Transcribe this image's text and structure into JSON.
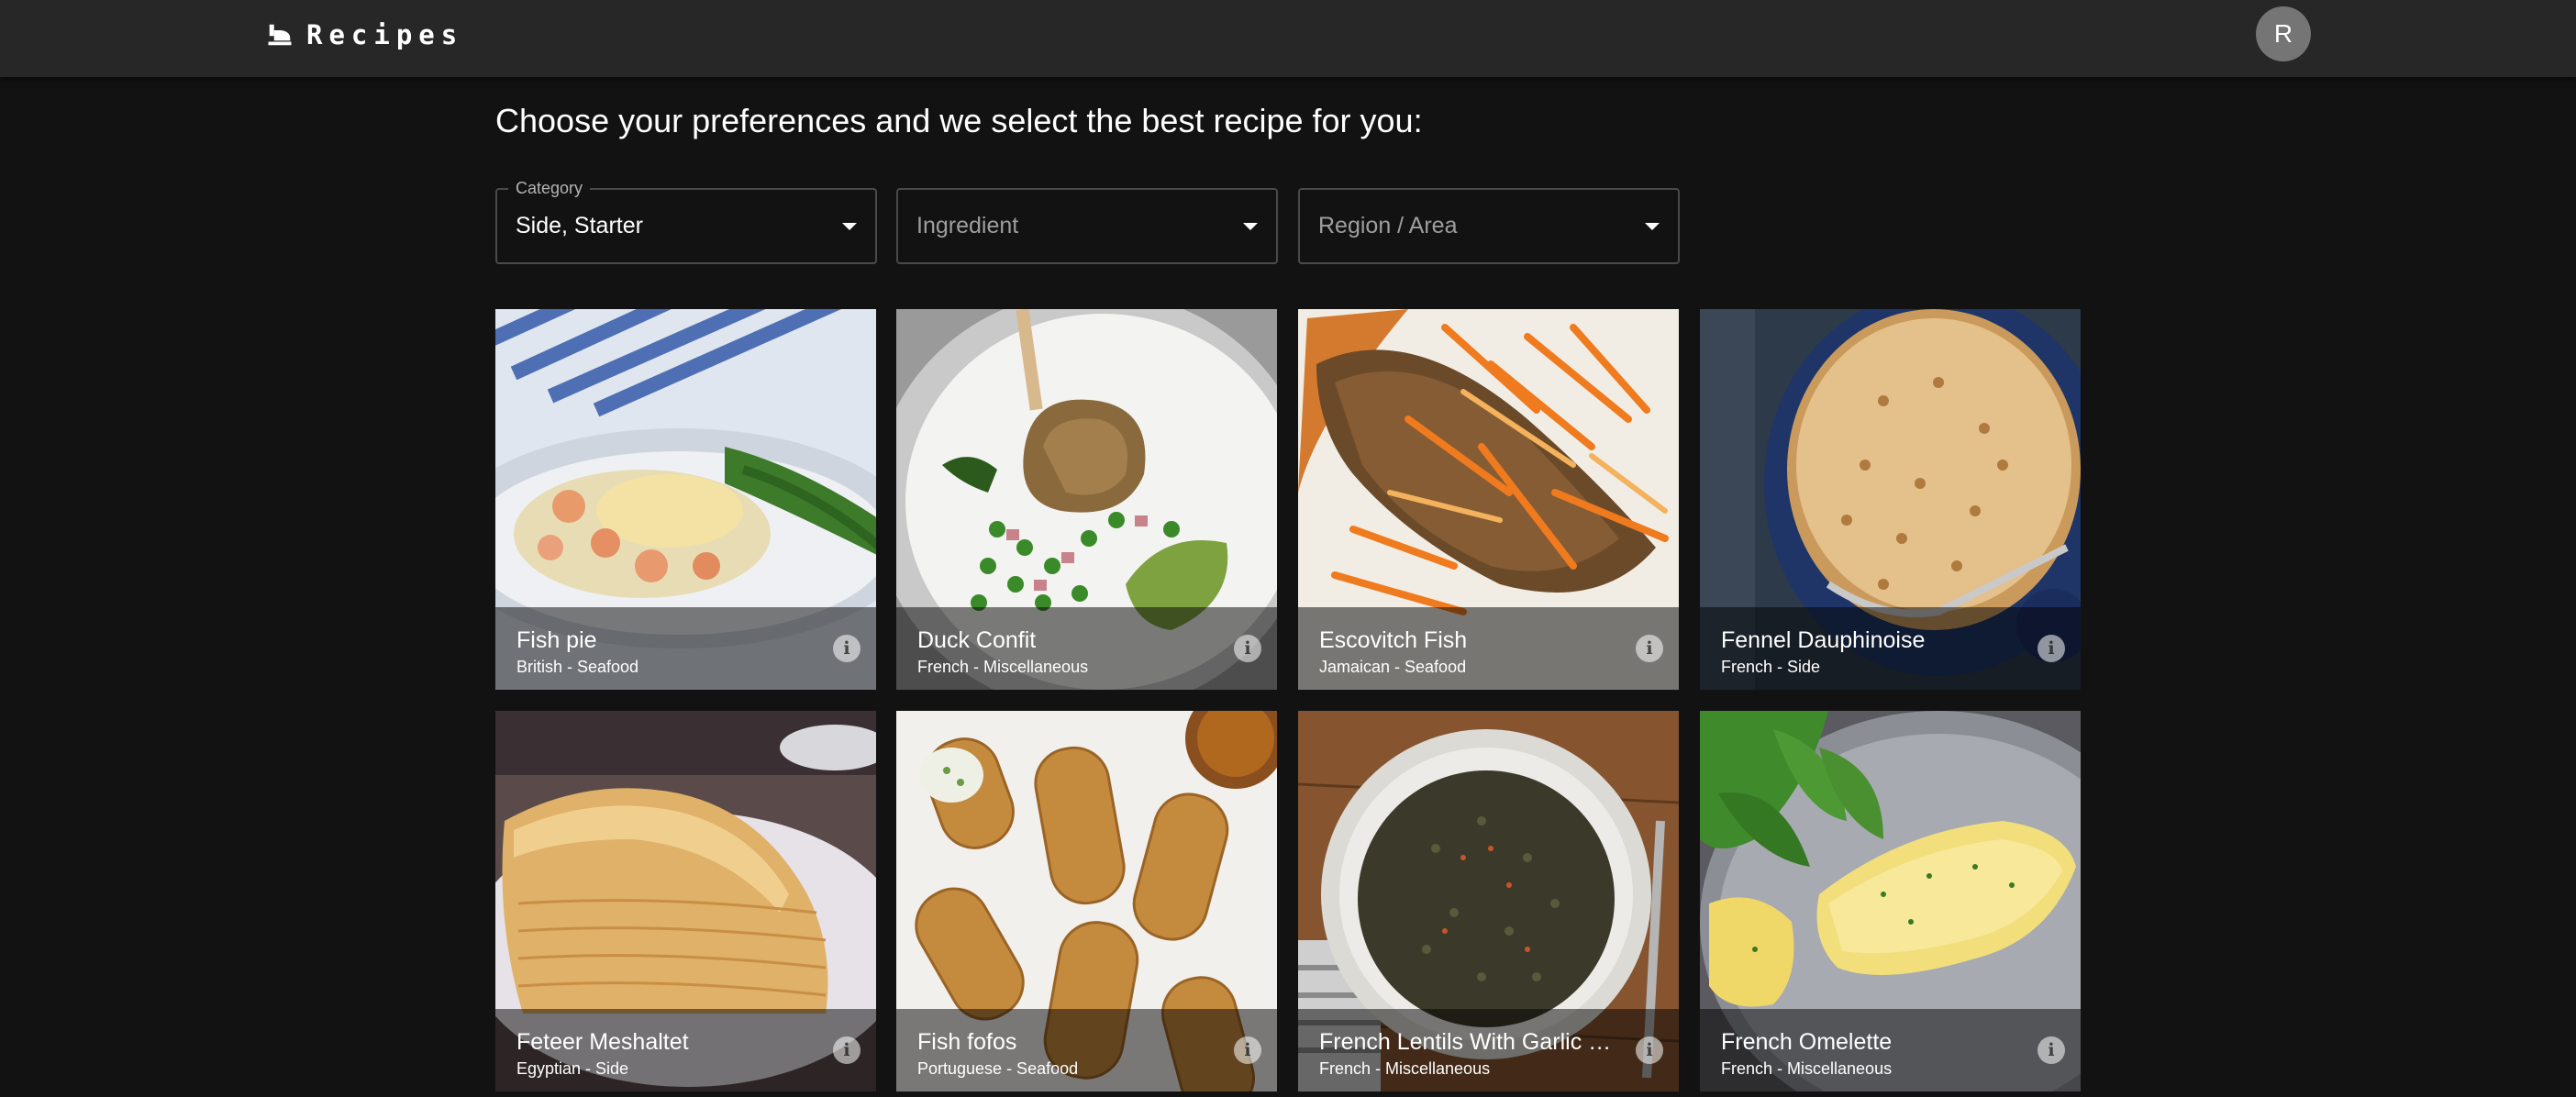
{
  "app": {
    "title": "Recipes",
    "avatar_initial": "R"
  },
  "heading": "Choose your preferences and we select the best recipe for you:",
  "filters": {
    "category": {
      "label": "Category",
      "value": "Side, Starter"
    },
    "ingredient": {
      "placeholder": "Ingredient"
    },
    "region": {
      "placeholder": "Region / Area"
    }
  },
  "recipes": [
    {
      "name": "Fish pie",
      "subtitle": "British - Seafood"
    },
    {
      "name": "Duck Confit",
      "subtitle": "French - Miscellaneous"
    },
    {
      "name": "Escovitch Fish",
      "subtitle": "Jamaican - Seafood"
    },
    {
      "name": "Fennel Dauphinoise",
      "subtitle": "French - Side"
    },
    {
      "name": "Feteer Meshaltet",
      "subtitle": "Egyptian - Side"
    },
    {
      "name": "Fish fofos",
      "subtitle": "Portuguese - Seafood"
    },
    {
      "name": "French Lentils With Garlic an...",
      "subtitle": "French - Miscellaneous"
    },
    {
      "name": "French Omelette",
      "subtitle": "French - Miscellaneous"
    }
  ],
  "icons": {
    "brand": "chef-hat-icon",
    "caret": "arrow-drop-down-icon",
    "info": "info-icon"
  },
  "colors": {
    "background": "#121212",
    "appbar": "#272727",
    "avatar": "#757575"
  }
}
